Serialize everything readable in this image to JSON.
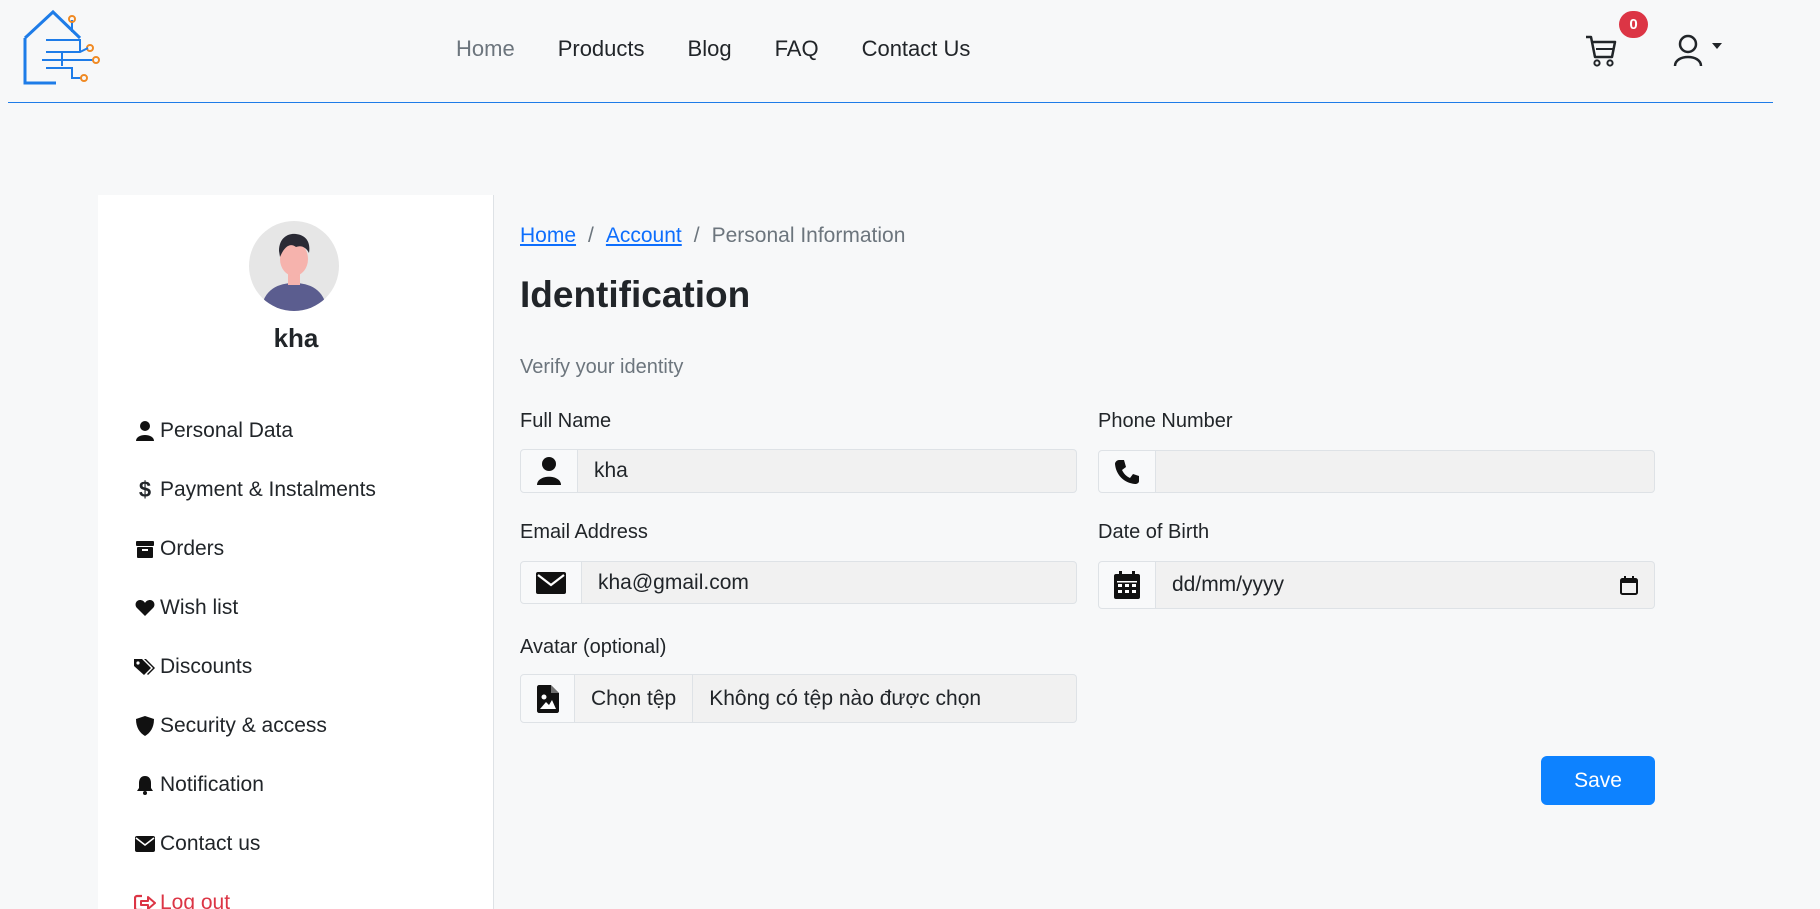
{
  "nav": {
    "items": [
      {
        "label": "Home",
        "active": true
      },
      {
        "label": "Products"
      },
      {
        "label": "Blog"
      },
      {
        "label": "FAQ"
      },
      {
        "label": "Contact Us"
      }
    ],
    "cart_count": "0",
    "accent": "#1e7ce8"
  },
  "sidebar": {
    "username": "kha",
    "items": [
      {
        "label": "Personal Data",
        "icon": "user-icon"
      },
      {
        "label": "Payment & Instalments",
        "icon": "dollar-icon"
      },
      {
        "label": "Orders",
        "icon": "box-icon"
      },
      {
        "label": "Wish list",
        "icon": "heart-icon"
      },
      {
        "label": "Discounts",
        "icon": "tags-icon"
      },
      {
        "label": "Security & access",
        "icon": "shield-icon"
      },
      {
        "label": "Notification",
        "icon": "bell-icon"
      },
      {
        "label": "Contact us",
        "icon": "envelope-icon"
      },
      {
        "label": "Log out",
        "icon": "sign-out-icon"
      }
    ]
  },
  "breadcrumb": {
    "home": "Home",
    "account": "Account",
    "current": "Personal Information",
    "separator": "/"
  },
  "main": {
    "title": "Identification",
    "subtitle": "Verify your identity",
    "full_name": {
      "label": "Full Name",
      "value": "kha"
    },
    "phone": {
      "label": "Phone Number",
      "value": ""
    },
    "email": {
      "label": "Email Address",
      "value": "kha@gmail.com"
    },
    "dob": {
      "label": "Date of Birth",
      "placeholder": "dd/mm/yyyy"
    },
    "avatar": {
      "label": "Avatar (optional)",
      "button": "Chọn tệp",
      "file_status": "Không có tệp nào được chọn"
    },
    "save": "Save"
  }
}
